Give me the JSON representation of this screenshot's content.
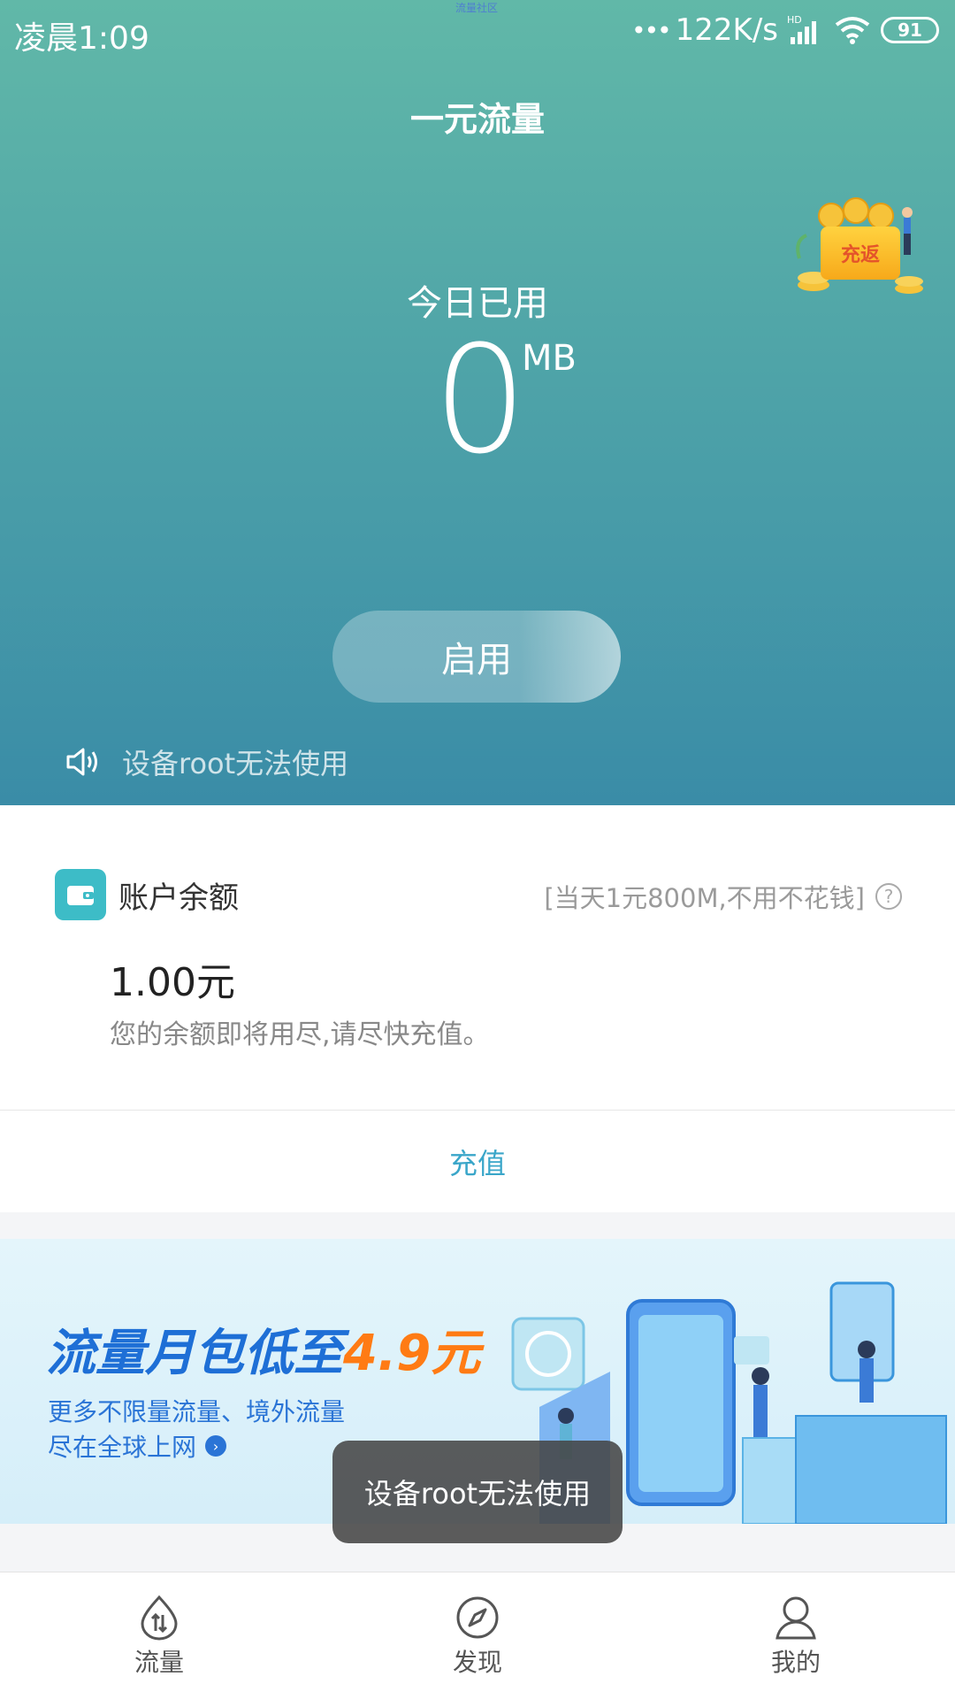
{
  "status_bar": {
    "time": "凌晨1:09",
    "carrier_tag": "流量社区",
    "speed": "122K/s",
    "network": "HD",
    "battery": "91"
  },
  "header": {
    "title": "一元流量"
  },
  "promo": {
    "label": "充返"
  },
  "usage": {
    "label": "今日已用",
    "value": "0",
    "unit": "MB"
  },
  "enable_button": {
    "label": "启用"
  },
  "notice": {
    "text": "设备root无法使用"
  },
  "account": {
    "title": "账户余额",
    "hint": "[当天1元800M,不用不花钱]",
    "help": "?",
    "balance": "1.00元",
    "note": "您的余额即将用尽,请尽快充值。",
    "recharge_label": "充值"
  },
  "banner": {
    "headline_main": "流量月包低至",
    "headline_price": "4.9元",
    "line1": "更多不限量流量、境外流量",
    "line2": "尽在全球上网",
    "arrow": "›"
  },
  "toast": {
    "text": "设备root无法使用"
  },
  "bottom_nav": {
    "items": [
      {
        "label": "流量",
        "icon": "traffic-icon"
      },
      {
        "label": "发现",
        "icon": "compass-icon"
      },
      {
        "label": "我的",
        "icon": "profile-icon"
      }
    ]
  },
  "colors": {
    "hero_top": "#61b8a8",
    "hero_bottom": "#3a8ca7",
    "accent_teal": "#3dbcc7",
    "link_blue": "#3aa6c9",
    "banner_blue": "#1e6fd6",
    "banner_orange": "#ff7b14"
  }
}
